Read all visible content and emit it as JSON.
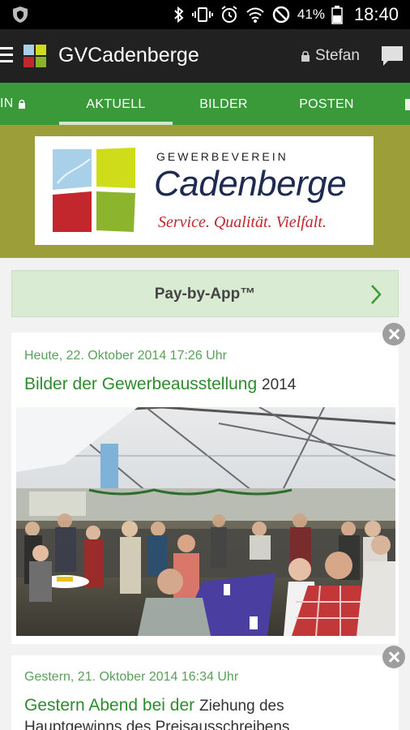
{
  "statusbar": {
    "battery_percent": "41%",
    "time": "18:40",
    "icons": [
      "shield-icon",
      "bluetooth-icon",
      "vibrate-icon",
      "alarm-icon",
      "wifi-icon",
      "no-signal-icon",
      "battery-icon"
    ]
  },
  "appbar": {
    "title": "GVCadenberge",
    "user": "Stefan",
    "icons": [
      "menu-icon",
      "app-logo-icon",
      "lock-icon",
      "chat-icon"
    ]
  },
  "tabs": [
    {
      "label": "IN",
      "active": false
    },
    {
      "label": "AKTUELL",
      "active": true
    },
    {
      "label": "BILDER",
      "active": false
    },
    {
      "label": "POSTEN",
      "active": false
    }
  ],
  "banner": {
    "small": "GEWERBEVEREIN",
    "big": "Cadenberge",
    "slogan": "Service. Qualität. Vielfalt."
  },
  "pay": {
    "label": "Pay-by-App™"
  },
  "news": [
    {
      "date": "Heute, 22. Oktober 2014 17:26 Uhr",
      "headline": "Bilder der Gewerbeausstellung",
      "headline_rest": "2014"
    },
    {
      "date": "Gestern, 21. Oktober 2014 16:34 Uhr",
      "headline": "Gestern Abend bei der",
      "headline_rest": "Ziehung des",
      "snippet": "Hauptgewinns des Preisausschreibens"
    }
  ],
  "colors": {
    "tab_bar": "#3a9a3a",
    "banner_bg": "#9c9e3a",
    "accent_green": "#2e8b2e",
    "appbar": "#212121"
  }
}
